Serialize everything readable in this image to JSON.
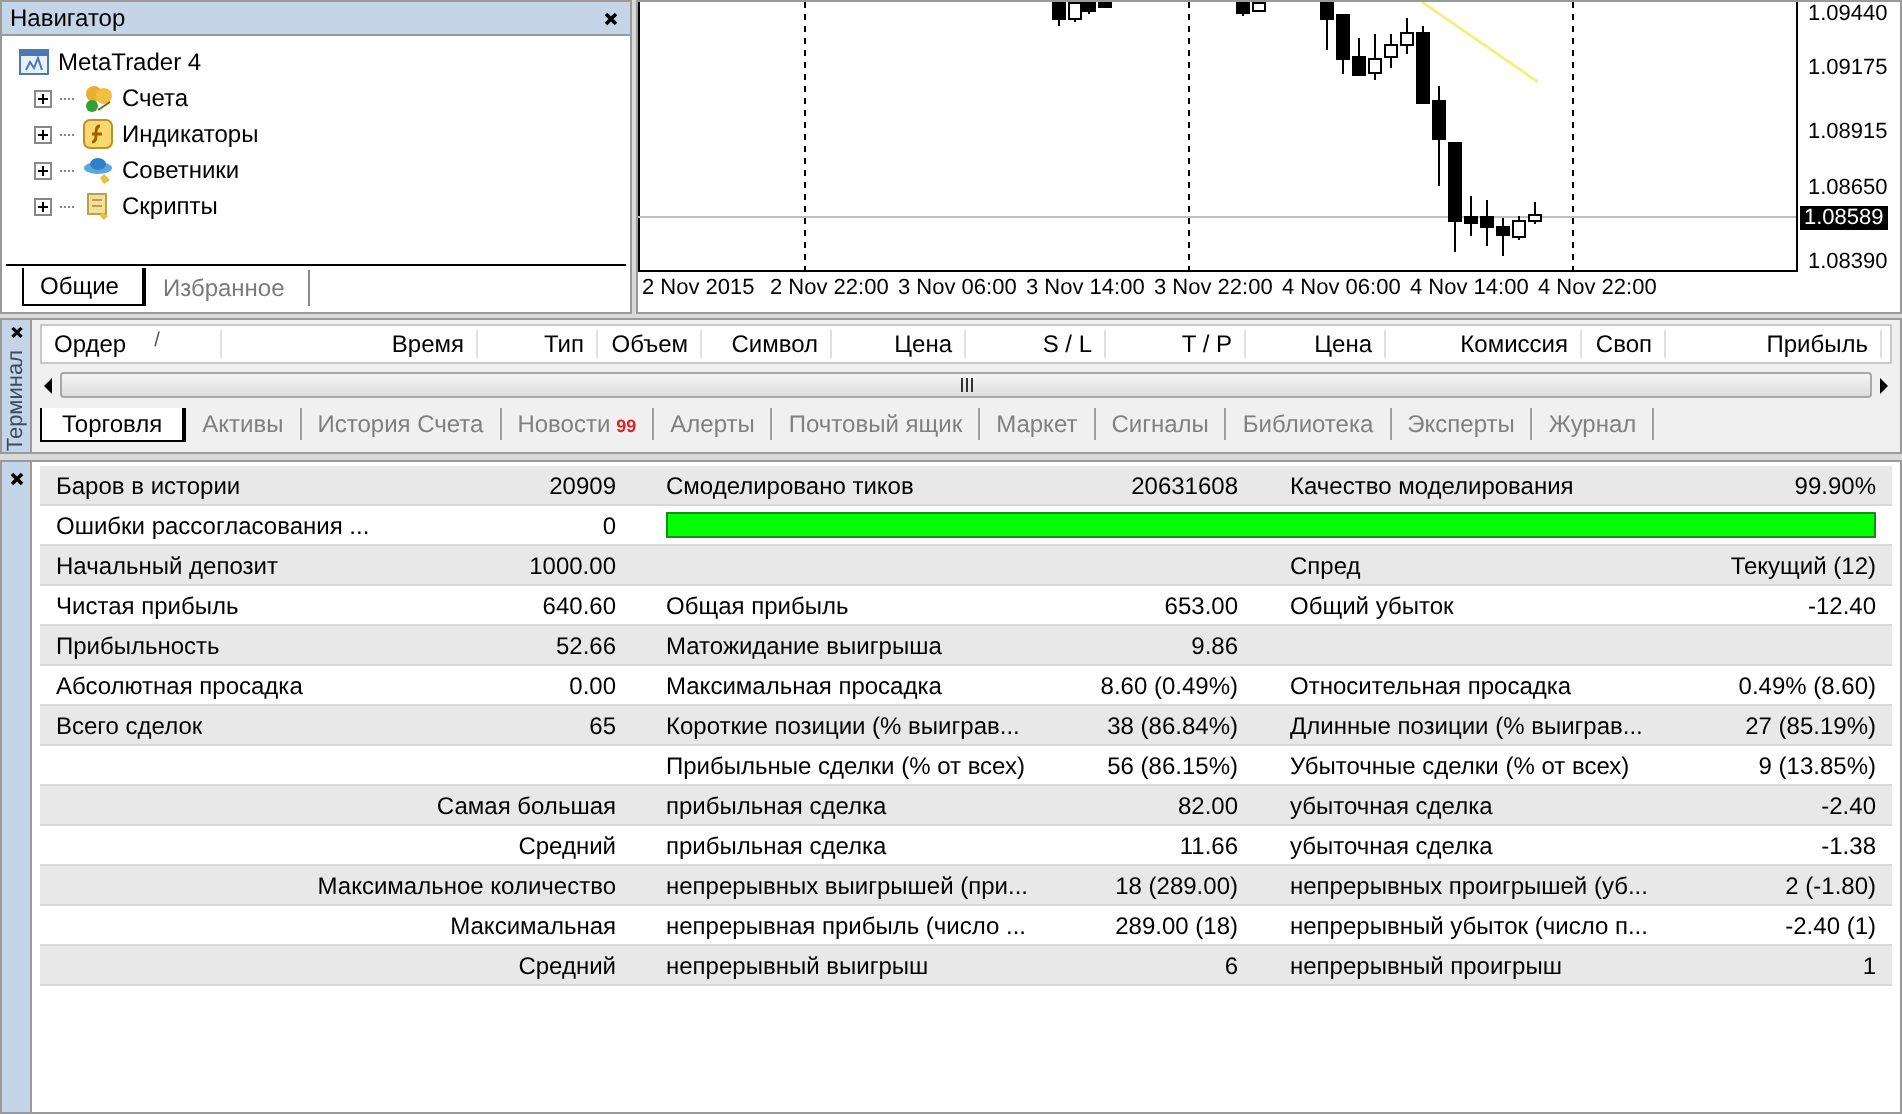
{
  "navigator": {
    "title": "Навигатор",
    "root": {
      "label": "MetaTrader 4",
      "children": [
        {
          "label": "Счета",
          "kind": "accounts",
          "expanded": false
        },
        {
          "label": "Индикаторы",
          "kind": "indicators",
          "expanded": false
        },
        {
          "label": "Советники",
          "kind": "experts",
          "expanded": false
        },
        {
          "label": "Скрипты",
          "kind": "scripts",
          "expanded": false
        }
      ]
    },
    "tabs": [
      {
        "label": "Общие",
        "selected": true
      },
      {
        "label": "Избранное",
        "selected": false
      }
    ]
  },
  "chart": {
    "time_labels": [
      "2 Nov 2015",
      "2 Nov 22:00",
      "3 Nov 06:00",
      "3 Nov 14:00",
      "3 Nov 22:00",
      "4 Nov 06:00",
      "4 Nov 14:00",
      "4 Nov 22:00"
    ],
    "price_labels": [
      "1.09440",
      "1.09175",
      "1.08915",
      "1.08650",
      "1.08390"
    ],
    "current_price": "1.08589"
  },
  "terminal": {
    "title": "Терминал",
    "columns": [
      {
        "label": "Ордер",
        "sort": "/"
      },
      {
        "label": "Время"
      },
      {
        "label": "Тип"
      },
      {
        "label": "Объем"
      },
      {
        "label": "Символ"
      },
      {
        "label": "Цена"
      },
      {
        "label": "S / L"
      },
      {
        "label": "T / P"
      },
      {
        "label": "Цена"
      },
      {
        "label": "Комиссия"
      },
      {
        "label": "Своп"
      },
      {
        "label": "Прибыль"
      }
    ],
    "tabs": [
      {
        "label": "Торговля",
        "selected": true
      },
      {
        "label": "Активы",
        "selected": false
      },
      {
        "label": "История Счета",
        "selected": false
      },
      {
        "label": "Новости",
        "badge": "99",
        "selected": false
      },
      {
        "label": "Алерты",
        "selected": false
      },
      {
        "label": "Почтовый ящик",
        "selected": false
      },
      {
        "label": "Маркет",
        "selected": false
      },
      {
        "label": "Сигналы",
        "selected": false
      },
      {
        "label": "Библиотека",
        "selected": false
      },
      {
        "label": "Эксперты",
        "selected": false
      },
      {
        "label": "Журнал",
        "selected": false
      }
    ]
  },
  "report": {
    "rows": [
      {
        "label": "Баров в истории",
        "value": "20909",
        "label_2": "Смоделировано тиков",
        "value_2": "20631608",
        "label_3": "Качество моделирования",
        "value_3": "99.90%"
      },
      {
        "label": "Ошибки рассогласования ...",
        "value": "0",
        "bar": {
          "level": 1
        }
      },
      {
        "label": "Начальный депозит",
        "value": "1000.00",
        "label_3": "Спред",
        "value_3": "Текущий (12)"
      },
      {
        "label": "Чистая прибыль",
        "value": "640.60",
        "label_2": "Общая прибыль",
        "value_2": "653.00",
        "label_3": "Общий убыток",
        "value_3": "-12.40"
      },
      {
        "label": "Прибыльность",
        "value": "52.66",
        "label_2": "Матожидание выигрыша",
        "value_2": "9.86"
      },
      {
        "label": "Абсолютная просадка",
        "value": "0.00",
        "label_2": "Максимальная просадка",
        "value_2": "8.60 (0.49%)",
        "label_3": "Относительная просадка",
        "value_3": "0.49% (8.60)"
      },
      {
        "label": "Всего сделок",
        "value": "65",
        "label_2": "Короткие позиции (% выиграв...",
        "value_2": "38 (86.84%)",
        "label_3": "Длинные позиции (% выиграв...",
        "value_3": "27 (85.19%)"
      },
      {
        "label_2": "Прибыльные сделки (% от всех)",
        "value_2": "56 (86.15%)",
        "label_3": "Убыточные сделки (% от всех)",
        "value_3": "9 (13.85%)"
      },
      {
        "heading": "Самая большая",
        "label_2": "прибыльная сделка",
        "value_2": "82.00",
        "label_3": "убыточная сделка",
        "value_3": "-2.40"
      },
      {
        "heading": "Средний",
        "label_2": "прибыльная сделка",
        "value_2": "11.66",
        "label_3": "убыточная сделка",
        "value_3": "-1.38"
      },
      {
        "heading": "Максимальное количество",
        "label_2": "непрерывных выигрышей (при...",
        "value_2": "18 (289.00)",
        "label_3": "непрерывных проигрышей (уб...",
        "value_3": "2 (-1.80)"
      },
      {
        "heading": "Максимальная",
        "label_2": "непрерывная прибыль (число ...",
        "value_2": "289.00 (18)",
        "label_3": "непрерывный убыток (число п...",
        "value_3": "-2.40 (1)"
      },
      {
        "heading": "Средний",
        "label_2": "непрерывный выигрыш",
        "value_2": "6",
        "label_3": "непрерывный проигрыш",
        "value_3": "1"
      }
    ]
  }
}
